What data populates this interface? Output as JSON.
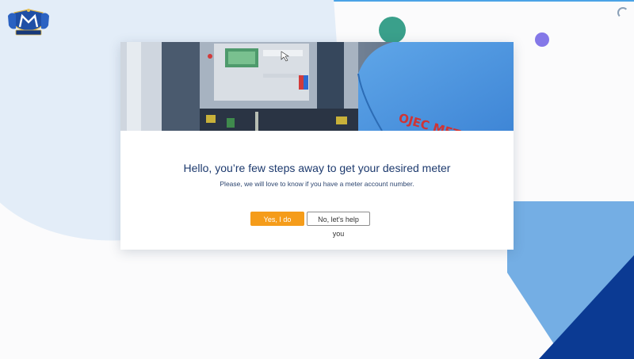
{
  "icons": {
    "logo": "company-crest-logo",
    "spinner": "loading-spinner-icon"
  },
  "hero": {
    "shirt_text": "OJEC METER COMP"
  },
  "card": {
    "title": "Hello, you’re few steps away to get your desired meter",
    "subtitle": "Please, we will love to know if you have a meter account number.",
    "buttons": {
      "yes_label": "Yes, I do have",
      "no_label": "No, let's help you"
    }
  },
  "colors": {
    "accent_orange": "#f59c1a",
    "title_navy": "#1d3a6e",
    "teal_circle": "#3aa08b",
    "purple_circle": "#8478e8",
    "light_blue": "#74aee4",
    "dark_blue": "#0b3a93"
  }
}
